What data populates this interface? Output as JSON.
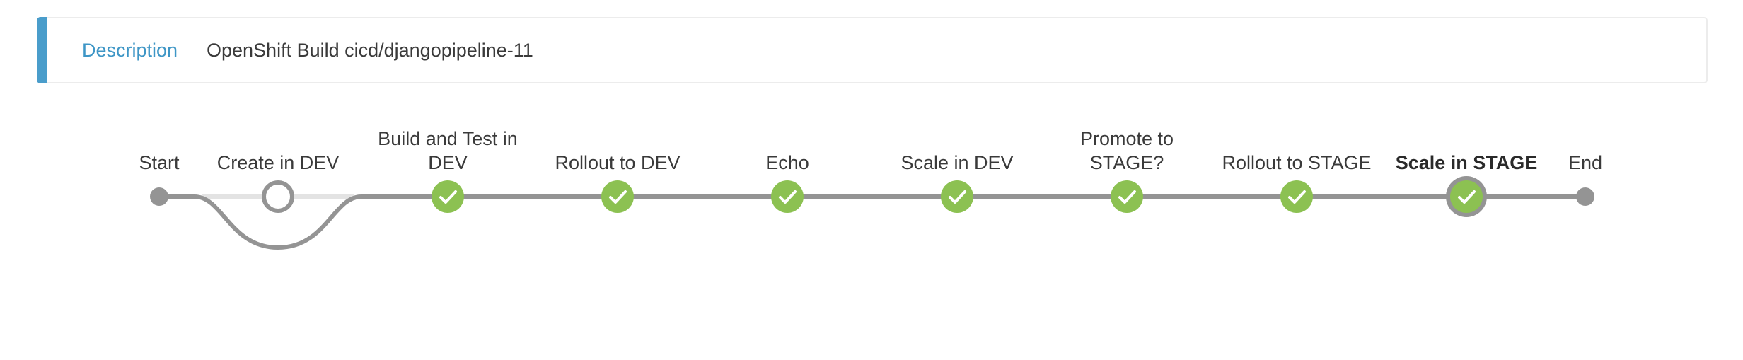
{
  "description": {
    "label": "Description",
    "value": "OpenShift Build cicd/djangopipeline-11"
  },
  "pipeline": {
    "start_label": "Start",
    "end_label": "End",
    "stages": [
      {
        "lines": [
          "Create in DEV"
        ],
        "status": "not-built",
        "selected": false
      },
      {
        "lines": [
          "Build and Test in",
          "DEV"
        ],
        "status": "success",
        "selected": false
      },
      {
        "lines": [
          "Rollout to DEV"
        ],
        "status": "success",
        "selected": false
      },
      {
        "lines": [
          "Echo"
        ],
        "status": "success",
        "selected": false
      },
      {
        "lines": [
          "Scale in DEV"
        ],
        "status": "success",
        "selected": false
      },
      {
        "lines": [
          "Promote to",
          "STAGE?"
        ],
        "status": "success",
        "selected": false
      },
      {
        "lines": [
          "Rollout to STAGE"
        ],
        "status": "success",
        "selected": false
      },
      {
        "lines": [
          "Scale in STAGE"
        ],
        "status": "success",
        "selected": true
      }
    ]
  },
  "colors": {
    "accent": "#4a9dcb",
    "success": "#8cc152",
    "line": "#949494",
    "line_skipped": "#e3e3e3",
    "selected_ring": "#949494"
  }
}
